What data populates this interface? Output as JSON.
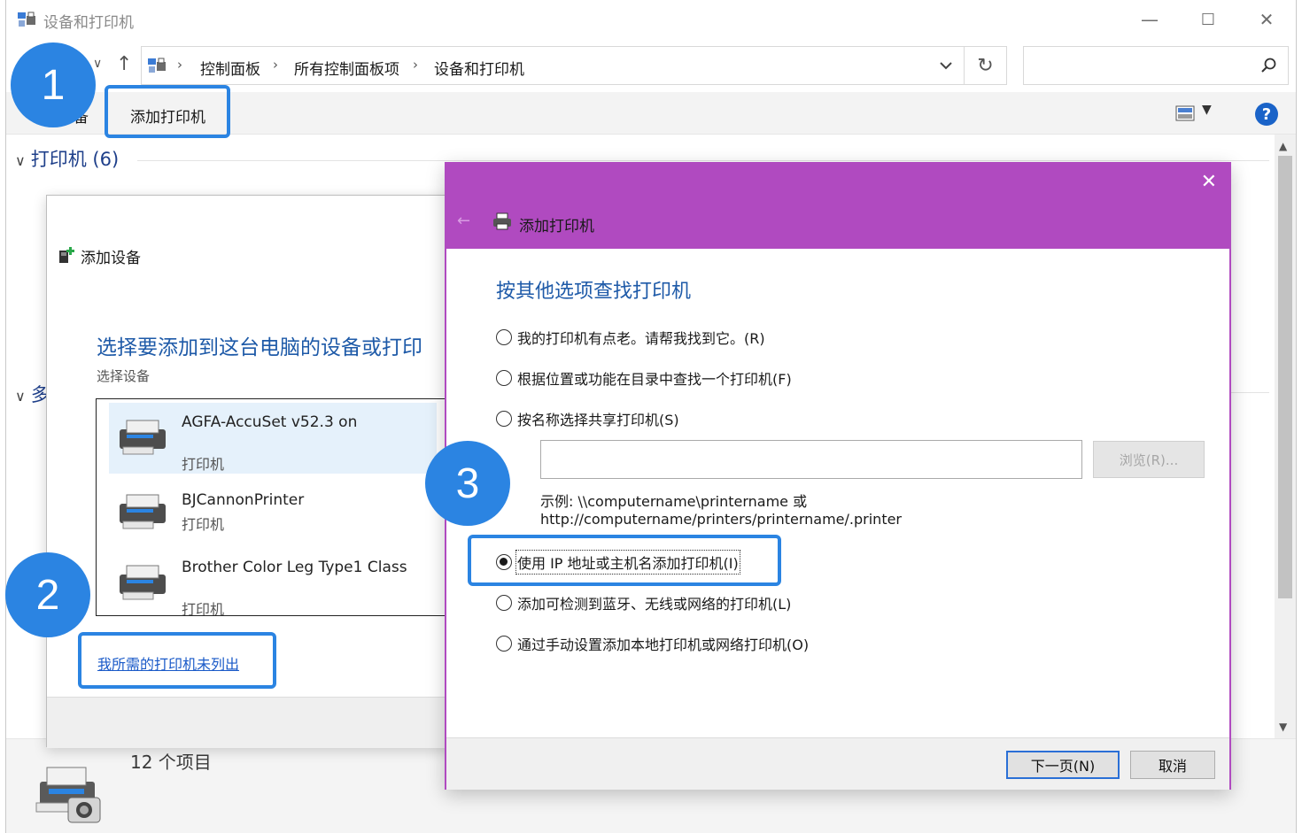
{
  "window": {
    "title": "设备和打印机",
    "min": "—",
    "max": "☐",
    "close": "✕"
  },
  "address": {
    "crumbs": [
      "控制面板",
      "所有控制面板项",
      "设备和打印机"
    ],
    "sep": "›",
    "refresh": "↻",
    "search_value": ""
  },
  "toolbar": {
    "add_device_partial": "备",
    "add_printer": "添加打印机",
    "view_dd": "▼",
    "help": "?"
  },
  "groups": {
    "printers": "打印机 (6)",
    "multimedia_partial": "多",
    "chevron": "∨"
  },
  "status": {
    "count": "12 个项目"
  },
  "add_device": {
    "title": "添加设备",
    "heading": "选择要添加到这台电脑的设备或打印",
    "sub": "选择设备",
    "devices": [
      {
        "name": "AGFA-AccuSet v52.3 on",
        "type": "打印机"
      },
      {
        "name": "BJCannonPrinter",
        "type": "打印机"
      },
      {
        "name": "Brother Color Leg Type1 Class",
        "type": "打印机"
      }
    ],
    "not_listed": "我所需的打印机未列出"
  },
  "add_printer": {
    "title": "添加打印机",
    "close": "✕",
    "back": "←",
    "heading": "按其他选项查找打印机",
    "options": [
      {
        "label": "我的打印机有点老。请帮我找到它。(R)",
        "selected": false
      },
      {
        "label": "根据位置或功能在目录中查找一个打印机(F)",
        "selected": false
      },
      {
        "label": "按名称选择共享打印机(S)",
        "selected": false
      },
      {
        "label": "使用 IP 地址或主机名添加打印机(I)",
        "selected": true
      },
      {
        "label": "添加可检测到蓝牙、无线或网络的打印机(L)",
        "selected": false
      },
      {
        "label": "通过手动设置添加本地打印机或网络打印机(O)",
        "selected": false
      }
    ],
    "share_value": "",
    "browse": "浏览(R)...",
    "example_line1": "示例: \\\\computername\\printername 或",
    "example_line2": "http://computername/printers/printername/.printer",
    "next": "下一页(N)",
    "cancel": "取消"
  },
  "callouts": [
    "1",
    "2",
    "3"
  ],
  "colors": {
    "accent_purple": "#b04ac0",
    "callout_blue": "#2b84e2",
    "heading_blue": "#1e5aa8",
    "link_blue": "#1a5ac8"
  }
}
